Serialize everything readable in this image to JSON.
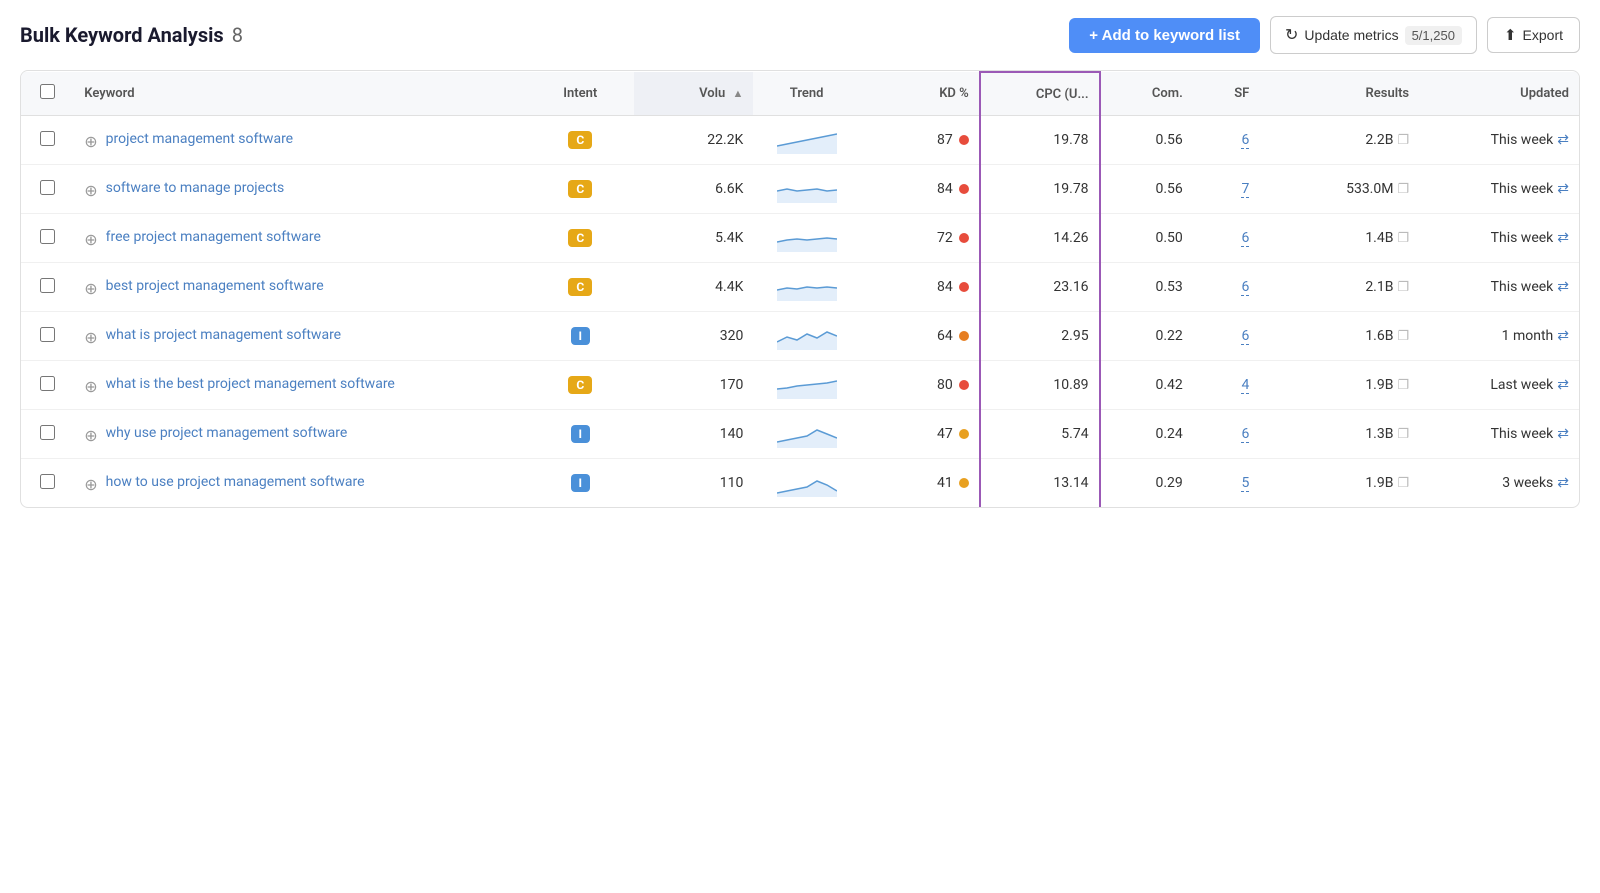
{
  "header": {
    "title": "Bulk Keyword Analysis",
    "count": "8",
    "add_button_label": "+ Add to keyword list",
    "update_button_label": "Update metrics",
    "metrics_count": "5/1,250",
    "export_button_label": "Export"
  },
  "table": {
    "columns": [
      {
        "id": "checkbox",
        "label": ""
      },
      {
        "id": "keyword",
        "label": "Keyword"
      },
      {
        "id": "intent",
        "label": "Intent"
      },
      {
        "id": "volume",
        "label": "Volu",
        "sorted": true
      },
      {
        "id": "trend",
        "label": "Trend"
      },
      {
        "id": "kd",
        "label": "KD %"
      },
      {
        "id": "cpc",
        "label": "CPC (U...",
        "highlighted": true
      },
      {
        "id": "com",
        "label": "Com."
      },
      {
        "id": "sf",
        "label": "SF"
      },
      {
        "id": "results",
        "label": "Results"
      },
      {
        "id": "updated",
        "label": "Updated"
      }
    ],
    "rows": [
      {
        "keyword": "project management software",
        "intent": "C",
        "intent_type": "c",
        "volume": "22.2K",
        "kd": "87",
        "kd_color": "red",
        "cpc": "19.78",
        "com": "0.56",
        "sf": "6",
        "results": "2.2B",
        "updated": "This week",
        "trend_type": "stable-up"
      },
      {
        "keyword": "software to manage projects",
        "intent": "C",
        "intent_type": "c",
        "volume": "6.6K",
        "kd": "84",
        "kd_color": "red",
        "cpc": "19.78",
        "com": "0.56",
        "sf": "7",
        "results": "533.0M",
        "updated": "This week",
        "trend_type": "stable-flat"
      },
      {
        "keyword": "free project management software",
        "intent": "C",
        "intent_type": "c",
        "volume": "5.4K",
        "kd": "72",
        "kd_color": "red",
        "cpc": "14.26",
        "com": "0.50",
        "sf": "6",
        "results": "1.4B",
        "updated": "This week",
        "trend_type": "stable-flat2"
      },
      {
        "keyword": "best project management software",
        "intent": "C",
        "intent_type": "c",
        "volume": "4.4K",
        "kd": "84",
        "kd_color": "red",
        "cpc": "23.16",
        "com": "0.53",
        "sf": "6",
        "results": "2.1B",
        "updated": "This week",
        "trend_type": "stable-flat3"
      },
      {
        "keyword": "what is project management software",
        "intent": "I",
        "intent_type": "i",
        "volume": "320",
        "kd": "64",
        "kd_color": "orange",
        "cpc": "2.95",
        "com": "0.22",
        "sf": "6",
        "results": "1.6B",
        "updated": "1 month",
        "trend_type": "wavy"
      },
      {
        "keyword": "what is the best project management software",
        "intent": "C",
        "intent_type": "c",
        "volume": "170",
        "kd": "80",
        "kd_color": "red",
        "cpc": "10.89",
        "com": "0.42",
        "sf": "4",
        "results": "1.9B",
        "updated": "Last week",
        "trend_type": "stable-up2"
      },
      {
        "keyword": "why use project management software",
        "intent": "I",
        "intent_type": "i",
        "volume": "140",
        "kd": "47",
        "kd_color": "yellow",
        "cpc": "5.74",
        "com": "0.24",
        "sf": "6",
        "results": "1.3B",
        "updated": "This week",
        "trend_type": "spike"
      },
      {
        "keyword": "how to use project management software",
        "intent": "I",
        "intent_type": "i",
        "volume": "110",
        "kd": "41",
        "kd_color": "yellow",
        "cpc": "13.14",
        "com": "0.29",
        "sf": "5",
        "results": "1.9B",
        "updated": "3 weeks",
        "trend_type": "spike2"
      }
    ]
  }
}
